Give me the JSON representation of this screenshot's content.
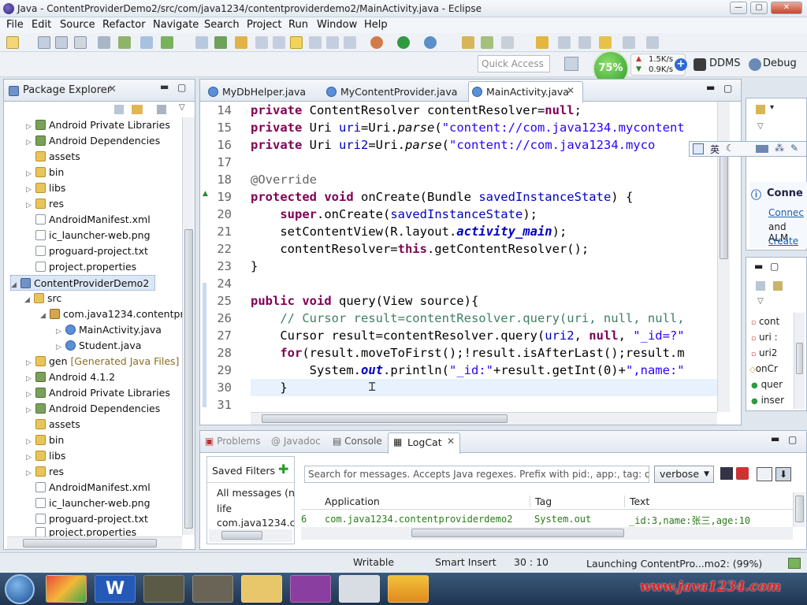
{
  "window": {
    "title": "Java - ContentProviderDemo2/src/com/java1234/contentproviderdemo2/MainActivity.java - Eclipse"
  },
  "menu": [
    "File",
    "Edit",
    "Source",
    "Refactor",
    "Navigate",
    "Search",
    "Project",
    "Run",
    "Window",
    "Help"
  ],
  "quick_access": {
    "placeholder": "Quick Access"
  },
  "net_widget": {
    "percent": "75%",
    "up": "1.5K/s",
    "down": "0.9K/s"
  },
  "perspectives": {
    "ddms": "DDMS",
    "debug": "Debug"
  },
  "package_explorer": {
    "title": "Package Explorer",
    "items": [
      {
        "label": "Android Private Libraries",
        "icon": "lib"
      },
      {
        "label": "Android Dependencies",
        "icon": "lib"
      },
      {
        "label": "assets",
        "icon": "folder"
      },
      {
        "label": "bin",
        "icon": "folder"
      },
      {
        "label": "libs",
        "icon": "folder"
      },
      {
        "label": "res",
        "icon": "folder"
      },
      {
        "label": "AndroidManifest.xml",
        "icon": "file"
      },
      {
        "label": "ic_launcher-web.png",
        "icon": "file"
      },
      {
        "label": "proguard-project.txt",
        "icon": "file"
      },
      {
        "label": "project.properties",
        "icon": "file"
      },
      {
        "label": "ContentProviderDemo2",
        "icon": "proj"
      },
      {
        "label": "src",
        "icon": "folder"
      },
      {
        "label": "com.java1234.contentprc",
        "icon": "pkg"
      },
      {
        "label": "MainActivity.java",
        "icon": "java"
      },
      {
        "label": "Student.java",
        "icon": "java"
      },
      {
        "label": "gen",
        "extra": "[Generated Java Files]",
        "icon": "folder"
      },
      {
        "label": "Android 4.1.2",
        "icon": "lib"
      },
      {
        "label": "Android Private Libraries",
        "icon": "lib"
      },
      {
        "label": "Android Dependencies",
        "icon": "lib"
      },
      {
        "label": "assets",
        "icon": "folder"
      },
      {
        "label": "bin",
        "icon": "folder"
      },
      {
        "label": "libs",
        "icon": "folder"
      },
      {
        "label": "res",
        "icon": "folder"
      },
      {
        "label": "AndroidManifest.xml",
        "icon": "file"
      },
      {
        "label": "ic_launcher-web.png",
        "icon": "file"
      },
      {
        "label": "proguard-project.txt",
        "icon": "file"
      },
      {
        "label": "project.properties",
        "icon": "file"
      }
    ]
  },
  "editor_tabs": [
    "MyDbHelper.java",
    "MyContentProvider.java",
    "MainActivity.java"
  ],
  "code_lines": [
    {
      "n": "14",
      "text": "private ContentResolver contentResolver=null;"
    },
    {
      "n": "15",
      "text": "private Uri uri=Uri.parse(\"content://com.java1234.mycontent"
    },
    {
      "n": "16",
      "text": "private Uri uri2=Uri.parse(\"content://com.java1234.myco"
    },
    {
      "n": "17",
      "text": ""
    },
    {
      "n": "18",
      "text": "@Override"
    },
    {
      "n": "19",
      "text": "protected void onCreate(Bundle savedInstanceState) {"
    },
    {
      "n": "20",
      "text": "    super.onCreate(savedInstanceState);"
    },
    {
      "n": "21",
      "text": "    setContentView(R.layout.activity_main);"
    },
    {
      "n": "22",
      "text": "    contentResolver=this.getContentResolver();"
    },
    {
      "n": "23",
      "text": "}"
    },
    {
      "n": "24",
      "text": ""
    },
    {
      "n": "25",
      "text": "public void query(View source){"
    },
    {
      "n": "26",
      "text": "    // Cursor result=contentResolver.query(uri, null, null,"
    },
    {
      "n": "27",
      "text": "    Cursor result=contentResolver.query(uri2, null, \"_id=?\""
    },
    {
      "n": "28",
      "text": "    for(result.moveToFirst();!result.isAfterLast();result.m"
    },
    {
      "n": "29",
      "text": "        System.out.println(\"_id:\"+result.getInt(0)+\",name:\""
    },
    {
      "n": "30",
      "text": "    }"
    },
    {
      "n": "31",
      "text": ""
    }
  ],
  "ime_bar": {
    "label": "英"
  },
  "outline_panel": {
    "title": "Conne",
    "link": "Connec",
    "text": "and ALM",
    "link2": "create",
    "items": [
      "cont",
      "uri :",
      "uri2",
      "onCr",
      "quer",
      "inser"
    ]
  },
  "bottom_tabs": [
    "Problems",
    "Javadoc",
    "Console",
    "LogCat"
  ],
  "saved_filters": {
    "title": "Saved Filters",
    "items": [
      "All messages (nc",
      "life",
      "com.java1234.co"
    ]
  },
  "logcat": {
    "search_placeholder": "Search for messages. Accepts Java regexes. Prefix with pid:, app:, tag: or t",
    "level": "verbose",
    "columns": [
      "Application",
      "Tag",
      "Text"
    ],
    "rows": [
      {
        "pid": "6",
        "app": "com.java1234.contentproviderdemo2",
        "tag": "System.out",
        "text": "_id:3,name:张三,age:10"
      }
    ]
  },
  "status": {
    "writable": "Writable",
    "insert": "Smart Insert",
    "pos": "30 : 10",
    "progress": "Launching ContentPro...mo2: (99%)"
  },
  "watermark": "www.java1234.com",
  "colors": {
    "keyword": "#7f0055",
    "string": "#2a00ff",
    "field": "#0000c0",
    "comment": "#3f7f5f"
  }
}
